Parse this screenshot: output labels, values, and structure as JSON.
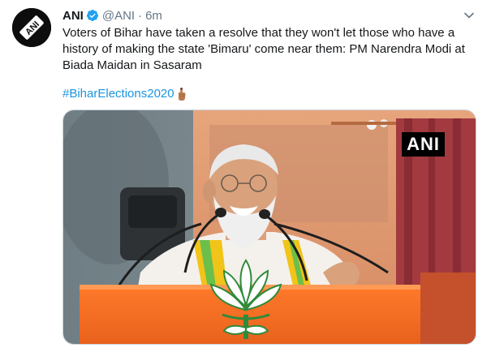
{
  "tweet": {
    "author_name": "ANI",
    "handle": "@ANI",
    "separator": "·",
    "time": "6m",
    "text": "Voters of Bihar have taken a resolve that they won't let those who have a history of making the state 'Bimaru' come near them: PM Narendra Modi at Biada Maidan in Sasaram",
    "hashtag": "#BiharElections2020",
    "avatar_logo_text": "ANI",
    "media": {
      "watermark": "ANI",
      "description_icons": [
        "lotus-emblem-icon"
      ]
    }
  },
  "icons": {
    "verified": "verified-badge-icon",
    "menu": "chevron-down-icon",
    "finger": "inked-finger-icon"
  },
  "colors": {
    "link": "#1b95e0",
    "verified": "#1da1f2",
    "muted": "#657786"
  }
}
